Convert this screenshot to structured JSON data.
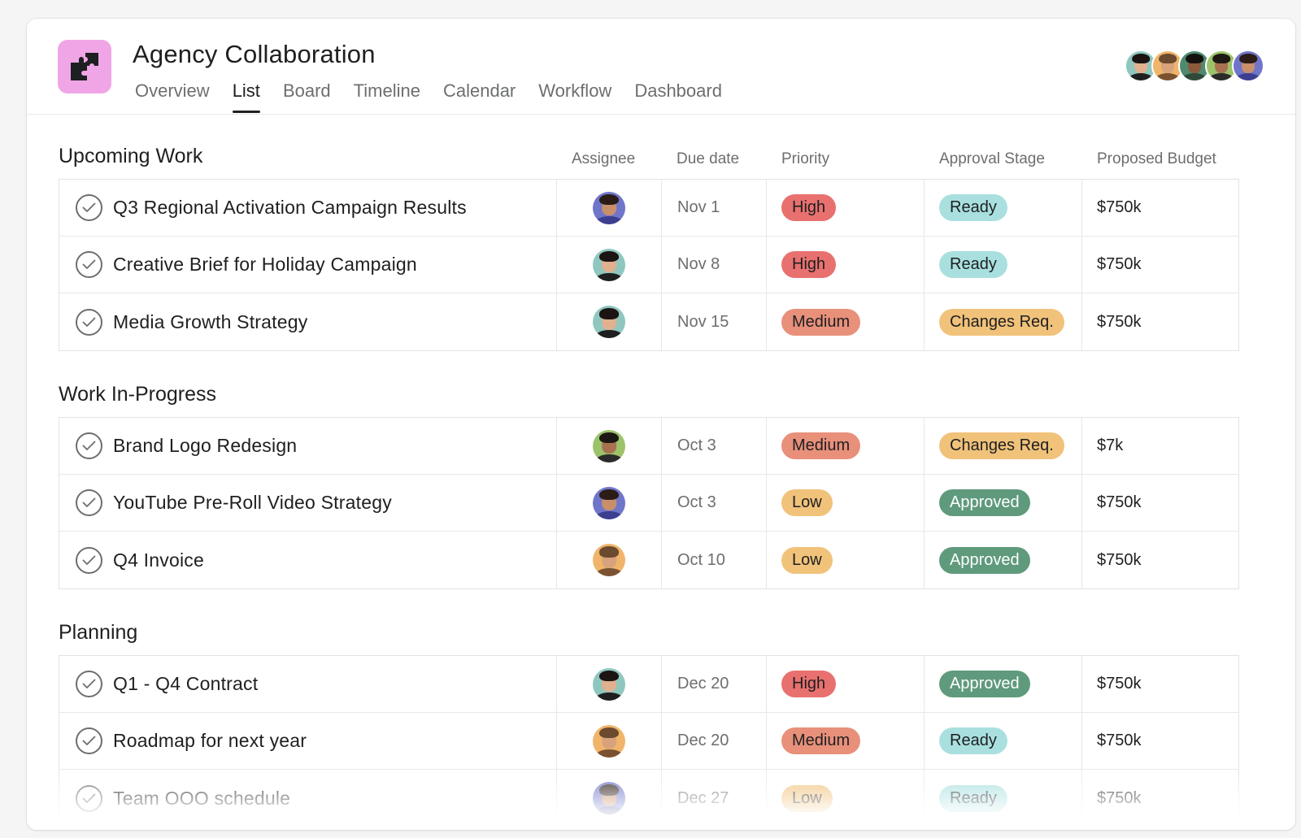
{
  "project": {
    "title": "Agency Collaboration",
    "icon": "puzzle-icon",
    "icon_bg": "#f0a6e6"
  },
  "tabs": [
    {
      "label": "Overview",
      "active": false
    },
    {
      "label": "List",
      "active": true
    },
    {
      "label": "Board",
      "active": false
    },
    {
      "label": "Timeline",
      "active": false
    },
    {
      "label": "Calendar",
      "active": false
    },
    {
      "label": "Workflow",
      "active": false
    },
    {
      "label": "Dashboard",
      "active": false
    }
  ],
  "members": [
    "woman-dark-hair",
    "man-glasses",
    "man-beard",
    "man-smiling",
    "man-blue"
  ],
  "columns": {
    "assignee": "Assignee",
    "due_date": "Due date",
    "priority": "Priority",
    "approval": "Approval Stage",
    "budget": "Proposed Budget"
  },
  "colors": {
    "High": "#e8716f",
    "Medium": "#e8907a",
    "Low": "#f1c27a",
    "Ready": "#a9e0df",
    "Changes Req.": "#f1c27a",
    "Approved": "#5f9a7c"
  },
  "sections": [
    {
      "title": "Upcoming Work",
      "rows": [
        {
          "name": "Q3 Regional Activation Campaign Results",
          "avatar": "man-blue",
          "due": "Nov 1",
          "priority": "High",
          "approval": "Ready",
          "budget": "$750k"
        },
        {
          "name": "Creative Brief for Holiday Campaign",
          "avatar": "woman-dark-hair",
          "due": "Nov 8",
          "priority": "High",
          "approval": "Ready",
          "budget": "$750k"
        },
        {
          "name": "Media Growth Strategy",
          "avatar": "woman-dark-hair",
          "due": "Nov 15",
          "priority": "Medium",
          "approval": "Changes Req.",
          "budget": "$750k"
        }
      ]
    },
    {
      "title": "Work In-Progress",
      "rows": [
        {
          "name": "Brand Logo Redesign",
          "avatar": "man-smiling",
          "due": "Oct 3",
          "priority": "Medium",
          "approval": "Changes Req.",
          "budget": "$7k"
        },
        {
          "name": "YouTube Pre-Roll Video Strategy",
          "avatar": "man-blue",
          "due": "Oct 3",
          "priority": "Low",
          "approval": "Approved",
          "budget": "$750k"
        },
        {
          "name": "Q4 Invoice",
          "avatar": "man-glasses",
          "due": "Oct 10",
          "priority": "Low",
          "approval": "Approved",
          "budget": "$750k"
        }
      ]
    },
    {
      "title": "Planning",
      "rows": [
        {
          "name": "Q1 - Q4 Contract",
          "avatar": "woman-dark-hair",
          "due": "Dec 20",
          "priority": "High",
          "approval": "Approved",
          "budget": "$750k"
        },
        {
          "name": "Roadmap for next year",
          "avatar": "man-glasses",
          "due": "Dec 20",
          "priority": "Medium",
          "approval": "Ready",
          "budget": "$750k"
        },
        {
          "name": "Team OOO schedule",
          "avatar": "man-blue",
          "due": "Dec 27",
          "priority": "Low",
          "approval": "Ready",
          "budget": "$750k"
        }
      ]
    }
  ]
}
